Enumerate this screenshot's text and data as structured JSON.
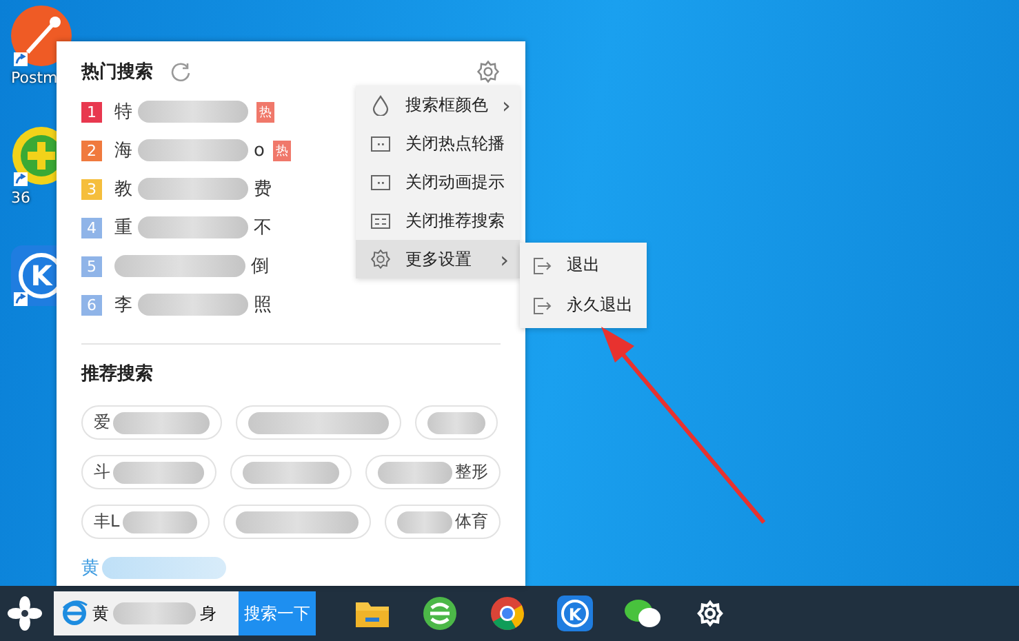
{
  "desktop_icons": [
    {
      "kind": "postman",
      "label": "Postm"
    },
    {
      "kind": "green-plus",
      "label": "36"
    },
    {
      "kind": "k-logo",
      "glyph": "K"
    }
  ],
  "hot_search": {
    "title": "热门搜索",
    "items": [
      {
        "rank": "1",
        "color": "#e8384f",
        "head": "特",
        "hot": true,
        "badge": "热"
      },
      {
        "rank": "2",
        "color": "#f07a3e",
        "head": "海",
        "tail": "o",
        "hot": true,
        "badge": "热"
      },
      {
        "rank": "3",
        "color": "#f5be3c",
        "head": "教",
        "tail": "费",
        "hot": false
      },
      {
        "rank": "4",
        "color": "#8fb4e8",
        "head": "重",
        "tail": "不",
        "hot": false
      },
      {
        "rank": "5",
        "color": "#8fb4e8",
        "tail": "倒",
        "hot": false
      },
      {
        "rank": "6",
        "color": "#8fb4e8",
        "head": "李",
        "tail": "照",
        "hot": false
      }
    ]
  },
  "settings_menu": [
    {
      "kind": "drop",
      "label": "搜索框颜色",
      "arrow": "›",
      "selected": false
    },
    {
      "kind": "dots",
      "label": "关闭热点轮播",
      "selected": false
    },
    {
      "kind": "dots",
      "label": "关闭动画提示",
      "selected": false
    },
    {
      "kind": "list",
      "label": "关闭推荐搜索",
      "selected": false
    },
    {
      "kind": "gear",
      "label": "更多设置",
      "arrow": "›",
      "selected": true
    }
  ],
  "submenu": [
    {
      "label": "退出"
    },
    {
      "label": "永久退出"
    }
  ],
  "recommend": {
    "title": "推荐搜索",
    "rows": [
      [
        {
          "head": "爱",
          "blurred": true
        },
        {
          "blurred": true
        },
        {
          "blurred": true
        }
      ],
      [
        {
          "head": "斗",
          "blurred": true
        },
        {
          "blurred": true
        },
        {
          "tail": "整形",
          "blurred": true
        }
      ],
      [
        {
          "head": "丰L",
          "blurred": true
        },
        {
          "blurred": true
        },
        {
          "tail": "体育",
          "blurred": true
        }
      ]
    ],
    "link": {
      "head": "黄",
      "blurred": true
    }
  },
  "taskbar": {
    "search_value_head": "黄",
    "search_value_tail": "身",
    "search_button": "搜索一下",
    "icons": [
      {
        "kind": "folder"
      },
      {
        "kind": "green-e"
      },
      {
        "kind": "chrome"
      },
      {
        "kind": "k-logo",
        "glyph": "K"
      },
      {
        "kind": "chat"
      },
      {
        "kind": "gear"
      }
    ]
  }
}
